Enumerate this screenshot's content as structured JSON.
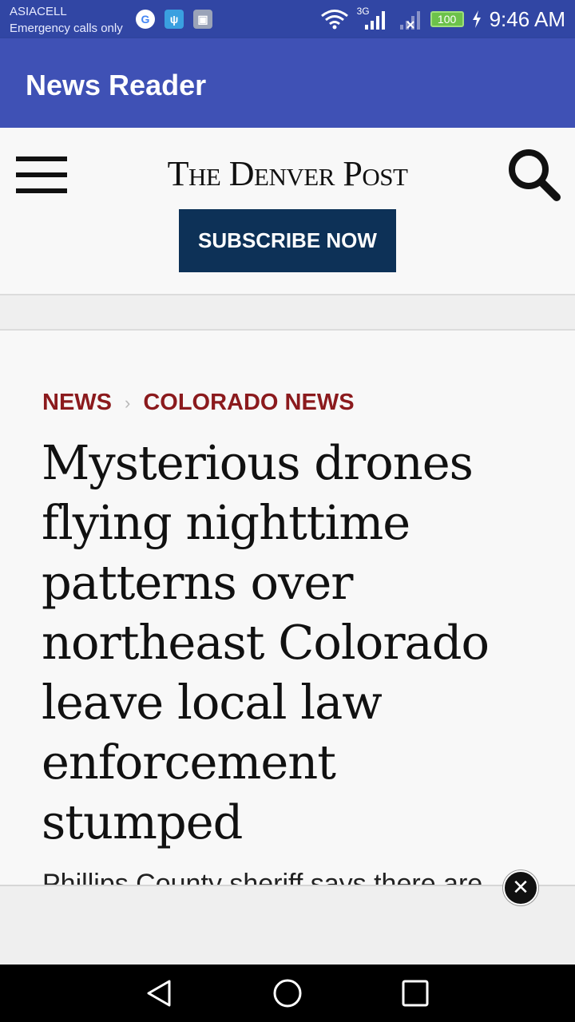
{
  "status_bar": {
    "carrier": "ASIACELL",
    "carrier_note": "Emergency calls only",
    "network_type": "3G",
    "battery": "100",
    "time": "9:46 AM",
    "notification_icons": [
      "google-icon",
      "usb-icon",
      "image-icon"
    ]
  },
  "app_bar": {
    "title": "News Reader"
  },
  "site": {
    "logo": "The Denver Post",
    "subscribe_label": "SUBSCRIBE NOW"
  },
  "article": {
    "breadcrumbs": [
      "NEWS",
      "COLORADO NEWS"
    ],
    "headline": "Mysterious drones flying nighttime patterns over northeast Colorado leave local law enforcement stumped",
    "subhead_partial": "Phillips County sheriff says there are"
  },
  "colors": {
    "status_bar": "#3146a4",
    "app_bar": "#3f51b5",
    "subscribe_button": "#0d3157",
    "breadcrumb": "#8b1a1d"
  }
}
